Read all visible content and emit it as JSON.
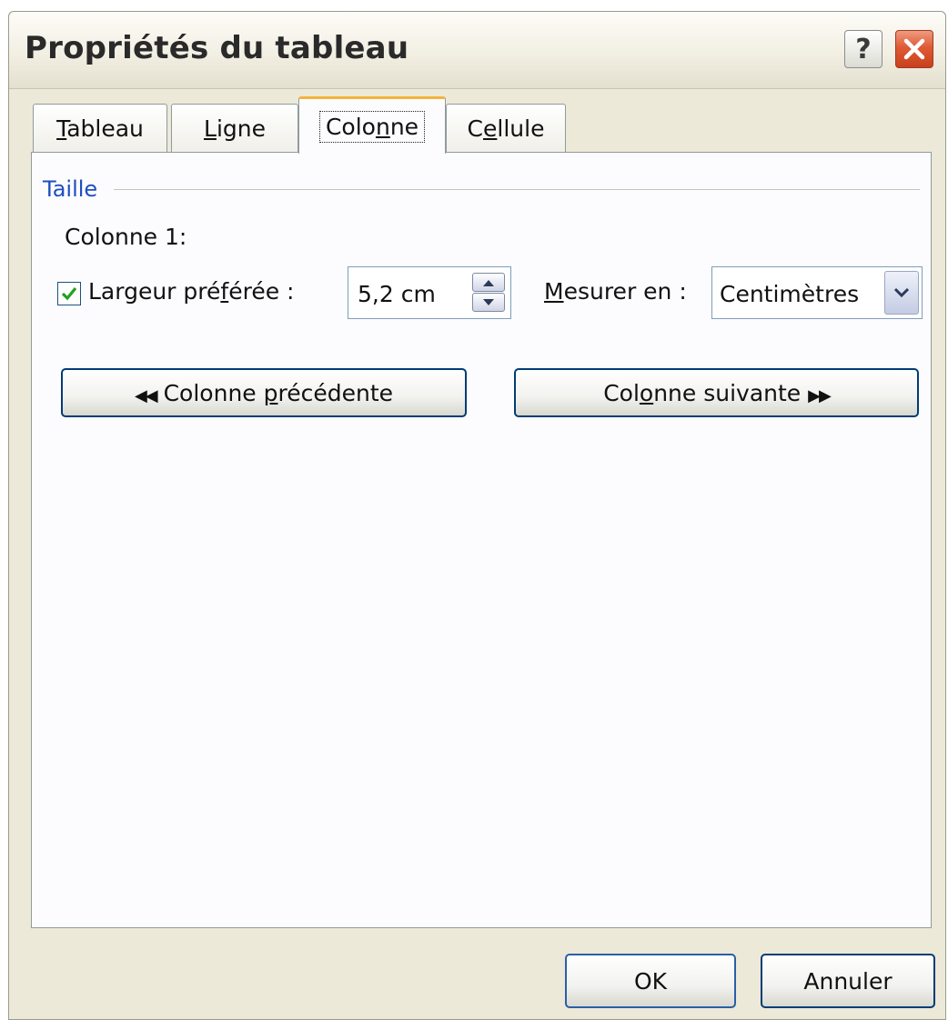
{
  "window": {
    "title": "Propriétés du tableau",
    "help_label": "?"
  },
  "tabs": [
    {
      "pre": "",
      "key": "T",
      "post": "ableau",
      "active": false
    },
    {
      "pre": "",
      "key": "L",
      "post": "igne",
      "active": false
    },
    {
      "pre": "Colo",
      "key": "n",
      "post": "ne",
      "active": true
    },
    {
      "pre": "C",
      "key": "e",
      "post": "llule",
      "active": false
    }
  ],
  "group": {
    "legend": "Taille",
    "column_label": "Colonne 1:",
    "preferred_width": {
      "checked": true,
      "label_pre": "Largeur pré",
      "label_key": "f",
      "label_post": "érée :",
      "value": "5,2 cm"
    },
    "measure": {
      "label_key": "M",
      "label_post": "esurer en :",
      "value": "Centimètres"
    },
    "prev_button": {
      "icon": "◀◀",
      "pre": " Colonne ",
      "key": "p",
      "post": "récédente"
    },
    "next_button": {
      "pre": "Col",
      "key": "o",
      "post": "nne suivante ",
      "icon": "▶▶"
    }
  },
  "footer": {
    "ok_label": "OK",
    "cancel_label": "Annuler"
  },
  "colors": {
    "accent_tab": "#f6b33c",
    "legend": "#1f4ec0",
    "close_button": "#df5a35",
    "check_mark": "#21a121"
  }
}
